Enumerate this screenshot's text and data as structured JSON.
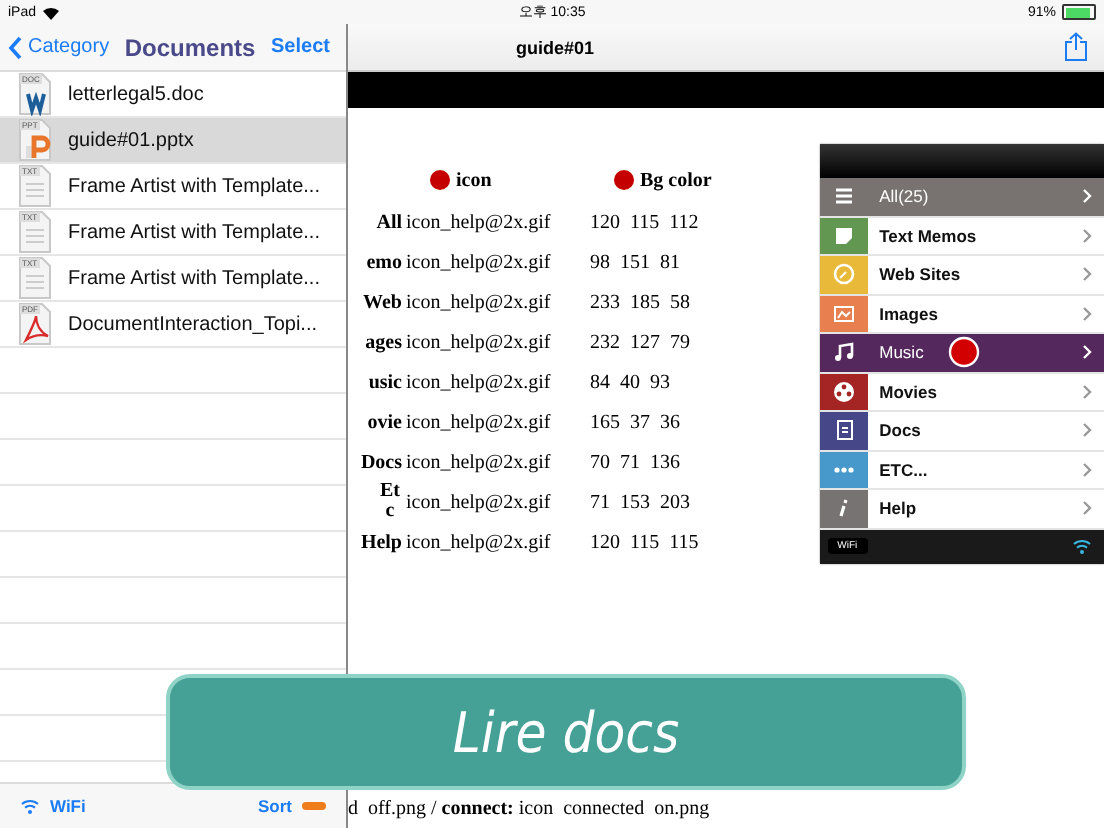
{
  "status_bar": {
    "device": "iPad",
    "time": "오후 10:35",
    "battery": "91%"
  },
  "sidebar": {
    "back": "Category",
    "title": "Documents",
    "action": "Select",
    "files": [
      {
        "name": "letterlegal5.doc",
        "kind": "doc",
        "badge": "DOC",
        "selected": false
      },
      {
        "name": "guide#01.pptx",
        "kind": "ppt",
        "badge": "PPT",
        "selected": true
      },
      {
        "name": "Frame Artist with Template...",
        "kind": "txt",
        "badge": "TXT",
        "selected": false
      },
      {
        "name": "Frame Artist with Template...",
        "kind": "txt",
        "badge": "TXT",
        "selected": false
      },
      {
        "name": "Frame Artist with Template...",
        "kind": "txt",
        "badge": "TXT",
        "selected": false
      },
      {
        "name": "DocumentInteraction_Topi...",
        "kind": "pdf",
        "badge": "PDF",
        "selected": false
      }
    ],
    "footer": {
      "wifi": "WiFi",
      "sort": "Sort"
    }
  },
  "viewer": {
    "title": "guide#01",
    "slide": {
      "headers": [
        "icon",
        "Bg color"
      ],
      "rows": [
        {
          "label": "All",
          "file": "icon_help@2x.gif",
          "rgb": "120  115  112"
        },
        {
          "label": "emo",
          "file": "icon_help@2x.gif",
          "rgb": "98  151  81"
        },
        {
          "label": "Web",
          "file": "icon_help@2x.gif",
          "rgb": "233  185  58"
        },
        {
          "label": "ages",
          "file": "icon_help@2x.gif",
          "rgb": "232  127  79"
        },
        {
          "label": "usic",
          "file": "icon_help@2x.gif",
          "rgb": "84  40  93"
        },
        {
          "label": "ovie",
          "file": "icon_help@2x.gif",
          "rgb": "165  37  36"
        },
        {
          "label": "Docs",
          "file": "icon_help@2x.gif",
          "rgb": "70  71  136"
        },
        {
          "label": "Etc",
          "file": "icon_help@2x.gif",
          "rgb": "71  153  203"
        },
        {
          "label": "Help",
          "file": "icon_help@2x.gif",
          "rgb": "120  115  115"
        }
      ],
      "phone_menu": {
        "items": [
          {
            "label": "All(25)",
            "color": "#787370",
            "selected": true
          },
          {
            "label": "Text Memos",
            "color": "#629751",
            "selected": false
          },
          {
            "label": "Web Sites",
            "color": "#e9b93a",
            "selected": false
          },
          {
            "label": "Images",
            "color": "#e87f4f",
            "selected": false
          },
          {
            "label": "Music",
            "color": "#54285d",
            "selected": true
          },
          {
            "label": "Movies",
            "color": "#a52524",
            "selected": false
          },
          {
            "label": "Docs",
            "color": "#464788",
            "selected": false
          },
          {
            "label": "ETC...",
            "color": "#4799cb",
            "selected": false
          },
          {
            "label": "Help",
            "color": "#787373",
            "selected": false
          }
        ],
        "footer": "WiFi"
      },
      "caption": "d  off.png / **connect:** icon  connected  on.png"
    }
  },
  "banner": "Lire docs"
}
